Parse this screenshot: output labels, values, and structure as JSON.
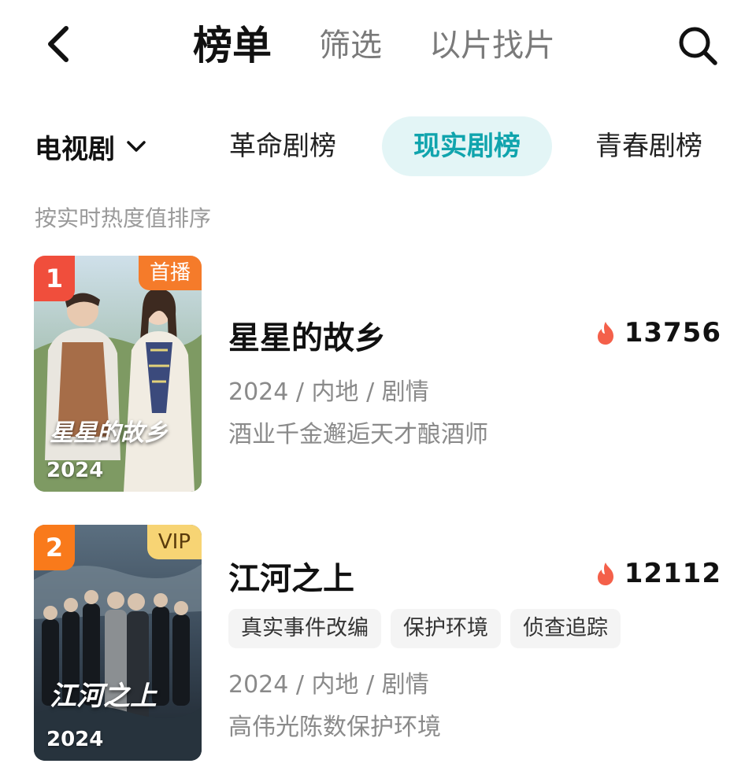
{
  "nav": {
    "tabs": [
      {
        "label": "榜单",
        "active": true
      },
      {
        "label": "筛选",
        "active": false
      },
      {
        "label": "以片找片",
        "active": false
      }
    ]
  },
  "category": {
    "selected": "电视剧",
    "rank_tabs": [
      {
        "label": "革命剧榜",
        "active": false
      },
      {
        "label": "现实剧榜",
        "active": true
      },
      {
        "label": "青春剧榜",
        "active": false
      }
    ]
  },
  "sort_note": "按实时热度值排序",
  "items": [
    {
      "rank": "1",
      "badge": "首播",
      "poster_year": "2024",
      "poster_title": "星星的故乡",
      "title": "星星的故乡",
      "heat": "13756",
      "meta": "2024 / 内地 / 剧情",
      "desc": "酒业千金邂逅天才酿酒师",
      "tags": []
    },
    {
      "rank": "2",
      "badge": "VIP",
      "poster_year": "2024",
      "poster_title": "江河之上",
      "title": "江河之上",
      "heat": "12112",
      "meta": "2024 / 内地 / 剧情",
      "desc": "高伟光陈数保护环境",
      "tags": [
        "真实事件改编",
        "保护环境",
        "侦查追踪"
      ]
    }
  ],
  "colors": {
    "accent": "#10a4ad",
    "accent_bg": "#e3f5f6",
    "rank1": "#f04e3c",
    "rank2": "#f97a1b",
    "premiere_badge": "#f57b2a",
    "vip_badge": "#f7d474",
    "flame": "#f4604a"
  },
  "icons": {
    "back": "chevron-left-icon",
    "search": "search-icon",
    "dropdown": "chevron-down-icon",
    "heat": "flame-icon"
  }
}
